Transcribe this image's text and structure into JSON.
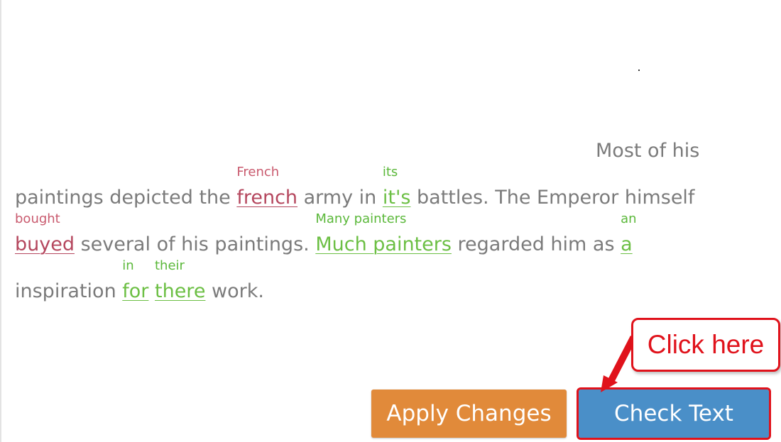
{
  "text": {
    "line0": [
      "Most of his"
    ],
    "line1": {
      "pre": "paintings depicted the ",
      "c1": {
        "original": "french",
        "suggestion": "French"
      },
      "mid1": " army in ",
      "c2": {
        "original": "it's",
        "suggestion": "its"
      },
      "post": " battles. The Emperor himself"
    },
    "line2": {
      "c1": {
        "original": "buyed",
        "suggestion": "bought"
      },
      "mid1": " several of his paintings. ",
      "c2": {
        "original": "Much painters",
        "suggestion": "Many painters"
      },
      "mid2": " regarded him as ",
      "c3": {
        "original": "a",
        "suggestion": "an"
      }
    },
    "line3": {
      "pre": "inspiration ",
      "c1": {
        "original": "for",
        "suggestion": "in"
      },
      "mid1": " ",
      "c2": {
        "original": "there",
        "suggestion": "their"
      },
      "post": " work."
    }
  },
  "buttons": {
    "apply_label": "Apply Changes",
    "check_label": "Check Text"
  },
  "annotation": {
    "callout_label": "Click here"
  },
  "colors": {
    "error_red": "#b5475e",
    "style_green": "#6cbf44",
    "apply_orange": "#e18a3a",
    "check_blue": "#4a8fc8",
    "annotation_red": "#e0121b"
  }
}
